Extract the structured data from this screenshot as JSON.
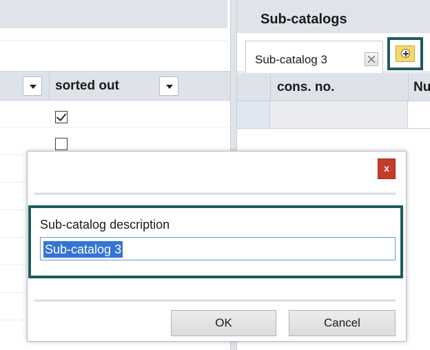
{
  "left_grid": {
    "columns": [
      {
        "label": "",
        "has_dropdown": true
      },
      {
        "label": "sorted out",
        "has_dropdown": true
      }
    ],
    "rows": [
      {
        "sorted_out": true
      },
      {
        "sorted_out": false
      }
    ]
  },
  "right_panel": {
    "title": "Sub-catalogs",
    "tabs": [
      {
        "label": "Sub-catalog 3",
        "closable": true
      }
    ],
    "add_tab_icon": "add-icon",
    "grid": {
      "columns": [
        "cons. no.",
        "Nu"
      ]
    }
  },
  "dialog": {
    "close_label": "x",
    "field_label": "Sub-catalog description",
    "field_value": "Sub-catalog 3",
    "ok_label": "OK",
    "cancel_label": "Cancel"
  },
  "colors": {
    "highlight": "#1f5b5e",
    "close_button": "#c43b2a",
    "add_button": "#f6d86a",
    "selection": "#3375d6",
    "header_bg": "#dfe3ea"
  }
}
